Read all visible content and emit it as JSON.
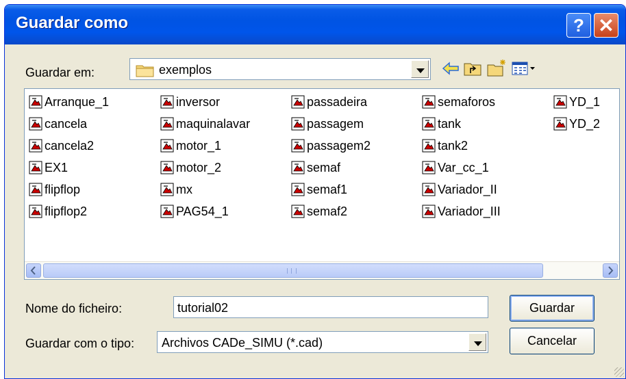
{
  "window": {
    "title": "Guardar como"
  },
  "titlebar_buttons": {
    "help": "?",
    "close": "✕"
  },
  "location": {
    "label": "Guardar em:",
    "value": "exemplos"
  },
  "toolbar": {
    "icons": [
      "back-arrow-icon",
      "up-folder-icon",
      "new-folder-icon",
      "view-menu-icon"
    ]
  },
  "files": [
    "Arranque_1",
    "cancela",
    "cancela2",
    "EX1",
    "flipflop",
    "flipflop2",
    "inversor",
    "maquinalavar",
    "motor_1",
    "motor_2",
    "mx",
    "PAG54_1",
    "passadeira",
    "passagem",
    "passagem2",
    "semaf",
    "semaf1",
    "semaf2",
    "semaforos",
    "tank",
    "tank2",
    "Var_cc_1",
    "Variador_II",
    "Variador_III",
    "YD_1",
    "YD_2"
  ],
  "filename": {
    "label": "Nome do ficheiro:",
    "value": "tutorial02"
  },
  "filetype": {
    "label": "Guardar com o tipo:",
    "value": "Archivos CADe_SIMU (*.cad)"
  },
  "buttons": {
    "save": "Guardar",
    "cancel": "Cancelar"
  },
  "colors": {
    "titlebar": "#0054e3",
    "dialog_bg": "#ece9d8",
    "close_button": "#c8411a"
  }
}
